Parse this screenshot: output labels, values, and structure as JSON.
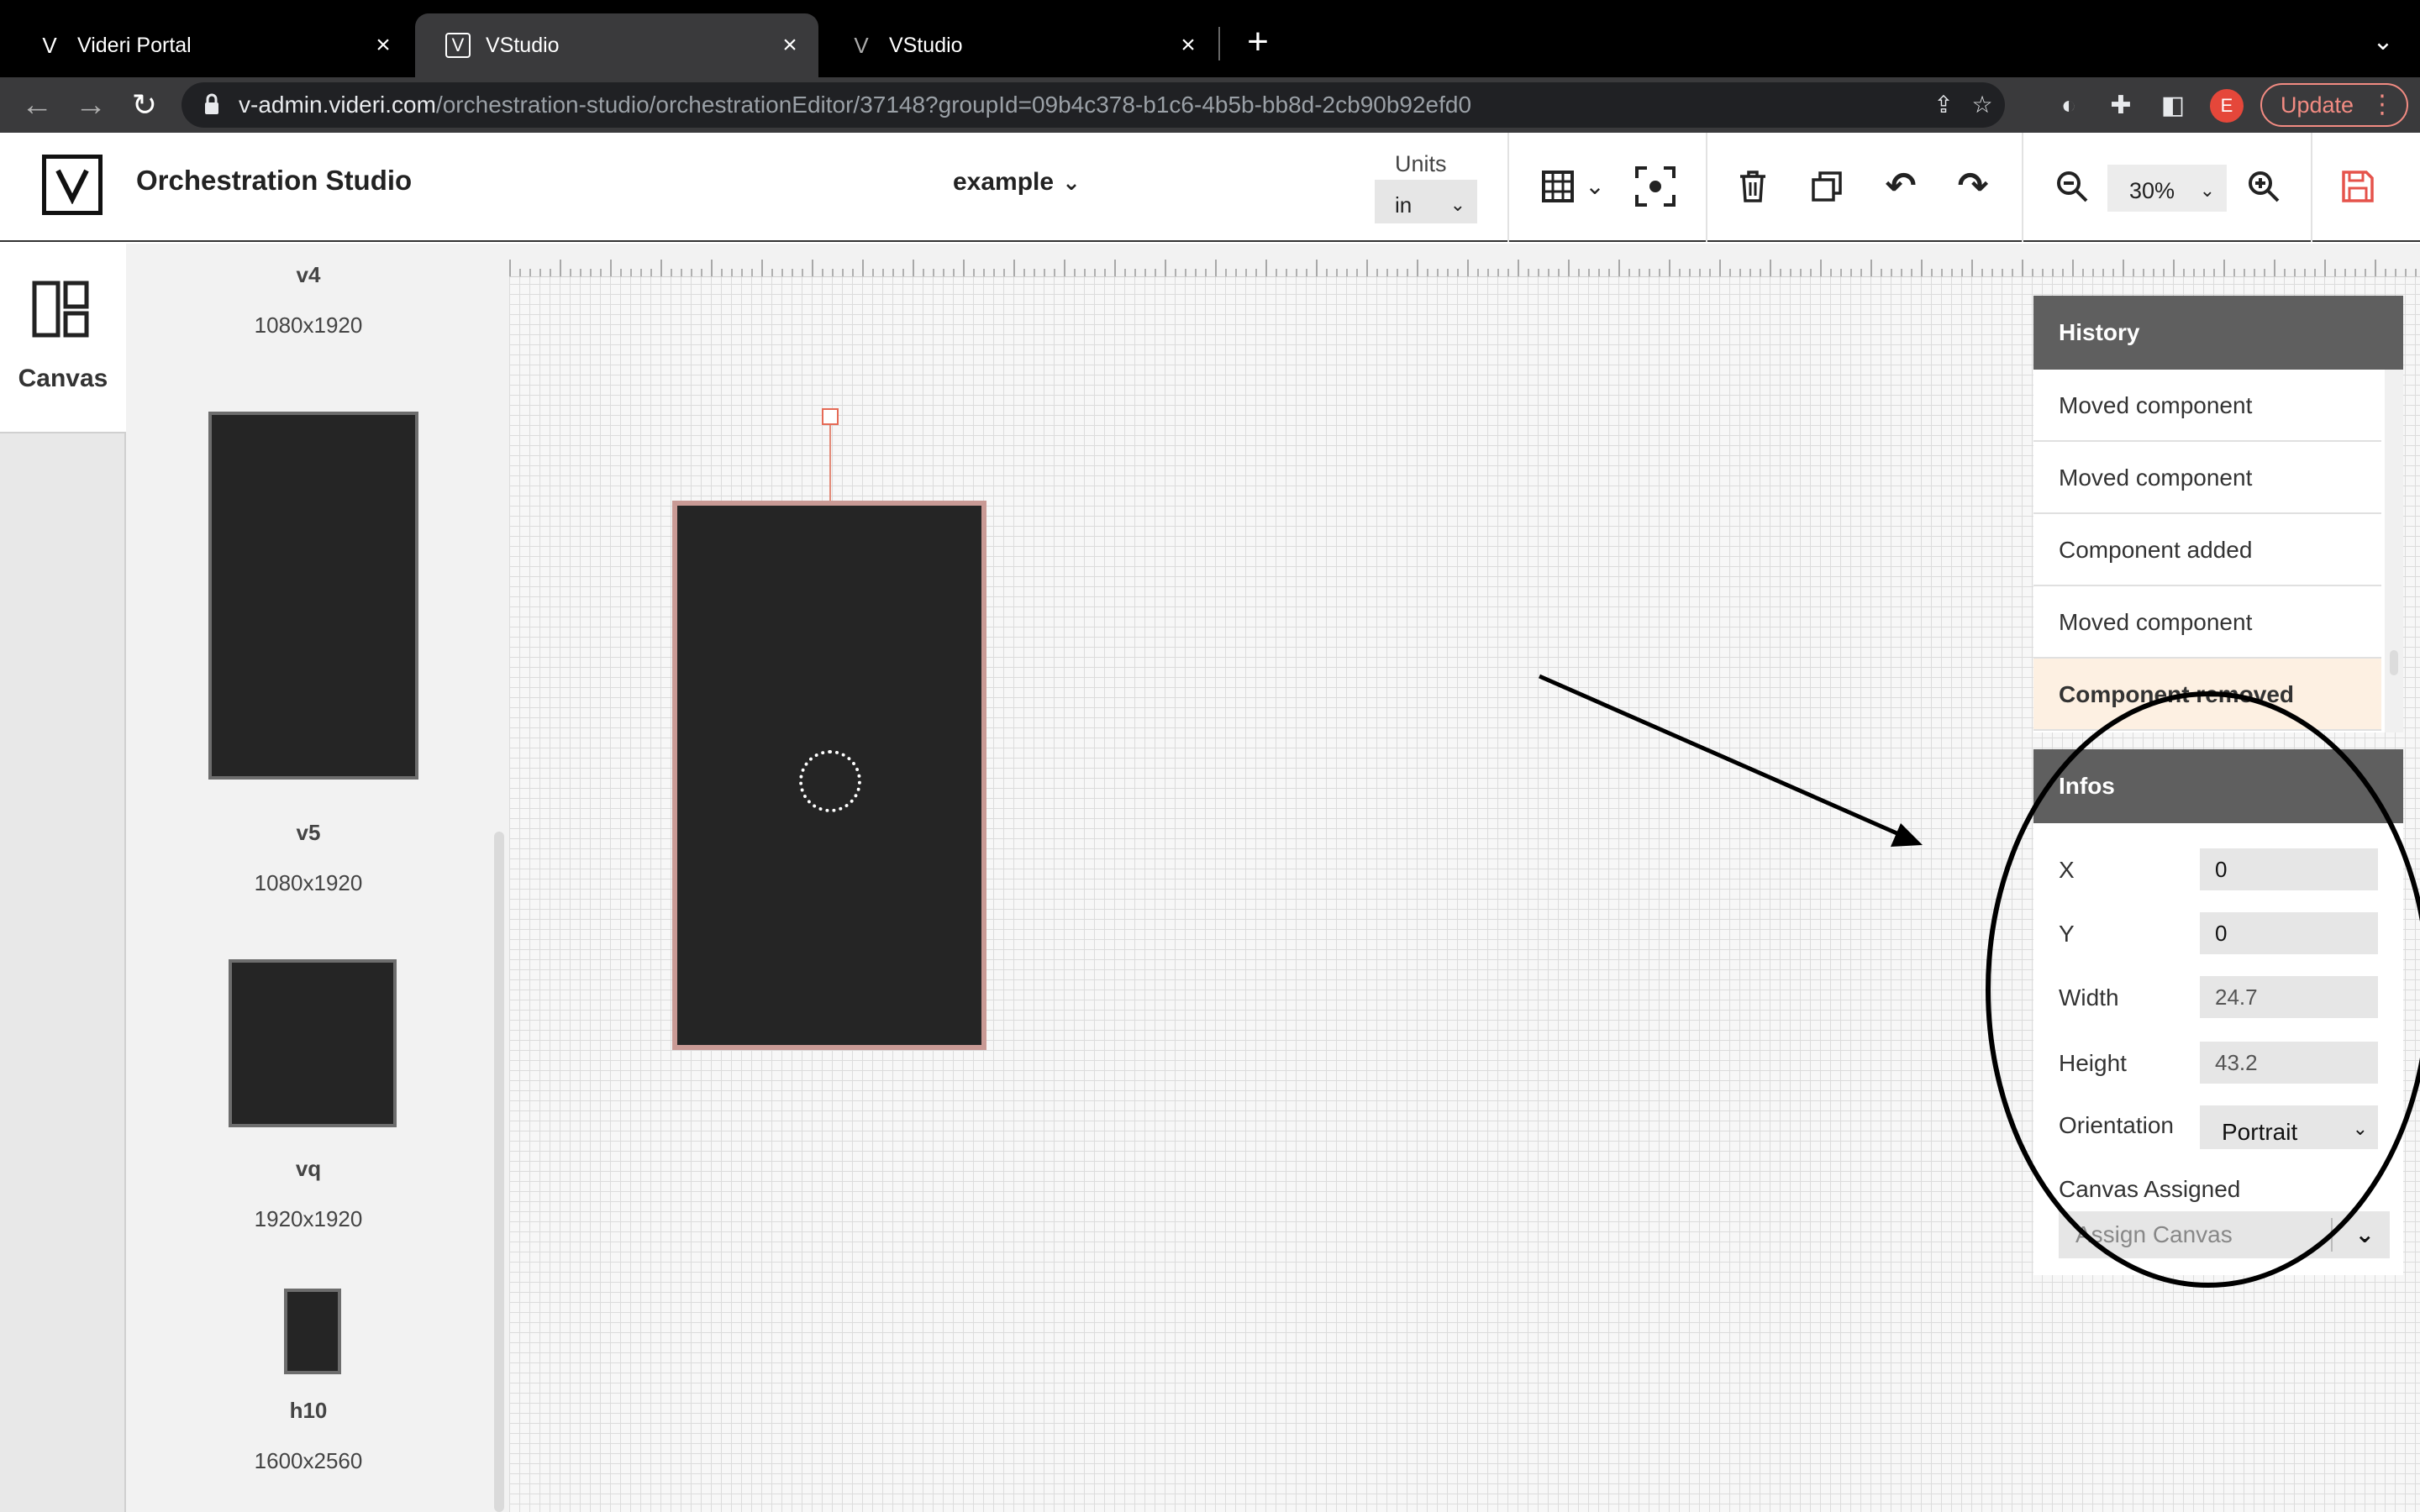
{
  "browser": {
    "tabs": [
      {
        "title": "Videri Portal",
        "close": "×"
      },
      {
        "title": "VStudio",
        "close": "×"
      },
      {
        "title": "VStudio",
        "close": "×"
      }
    ],
    "new_tab": "+",
    "tab_menu": "⌄",
    "url_host": "v-admin.videri.com",
    "url_path": "/orchestration-studio/orchestrationEditor/37148?groupId=09b4c378-b1c6-4b5b-bb8d-2cb90b92efd0",
    "profile_initial": "E",
    "update_label": "Update"
  },
  "header": {
    "app_title": "Orchestration Studio",
    "project": "example",
    "units_label": "Units",
    "units_value": "in",
    "zoom_value": "30%"
  },
  "rail": {
    "canvas_label": "Canvas"
  },
  "library": [
    {
      "name": "v4",
      "resolution": "1080x1920"
    },
    {
      "name": "v5",
      "resolution": "1080x1920"
    },
    {
      "name": "vq",
      "resolution": "1920x1920"
    },
    {
      "name": "h10",
      "resolution": "1600x2560"
    }
  ],
  "history": {
    "title": "History",
    "items": [
      "Moved component",
      "Moved component",
      "Component added",
      "Moved component",
      "Component removed"
    ]
  },
  "infos": {
    "title": "Infos",
    "x_label": "X",
    "x_value": "0",
    "y_label": "Y",
    "y_value": "0",
    "width_label": "Width",
    "width_value": "24.7",
    "height_label": "Height",
    "height_value": "43.2",
    "orientation_label": "Orientation",
    "orientation_value": "Portrait",
    "canvas_assigned_label": "Canvas Assigned",
    "canvas_assigned_placeholder": "Assign Canvas"
  },
  "colors": {
    "accent_save": "#e5534b",
    "selection_border": "#c99a95",
    "panel_header": "#5f5f5f",
    "history_current_bg": "#fdf0e2"
  }
}
